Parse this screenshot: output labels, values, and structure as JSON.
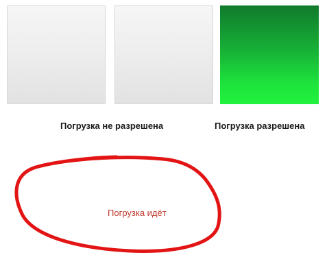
{
  "tiles": [
    {
      "state": "disabled",
      "colors": [
        "#f6f6f6",
        "#e2e2e2"
      ]
    },
    {
      "state": "disabled",
      "colors": [
        "#f6f6f6",
        "#e2e2e2"
      ]
    },
    {
      "state": "active",
      "colors": [
        "#117a2c",
        "#22f23f"
      ]
    }
  ],
  "captions": {
    "not_allowed": "Погрузка не разрешена",
    "allowed": "Погрузка разрешена"
  },
  "status": {
    "text": "Погрузка идёт",
    "text_color": "#c0392b",
    "outline_color": "#e21414"
  }
}
